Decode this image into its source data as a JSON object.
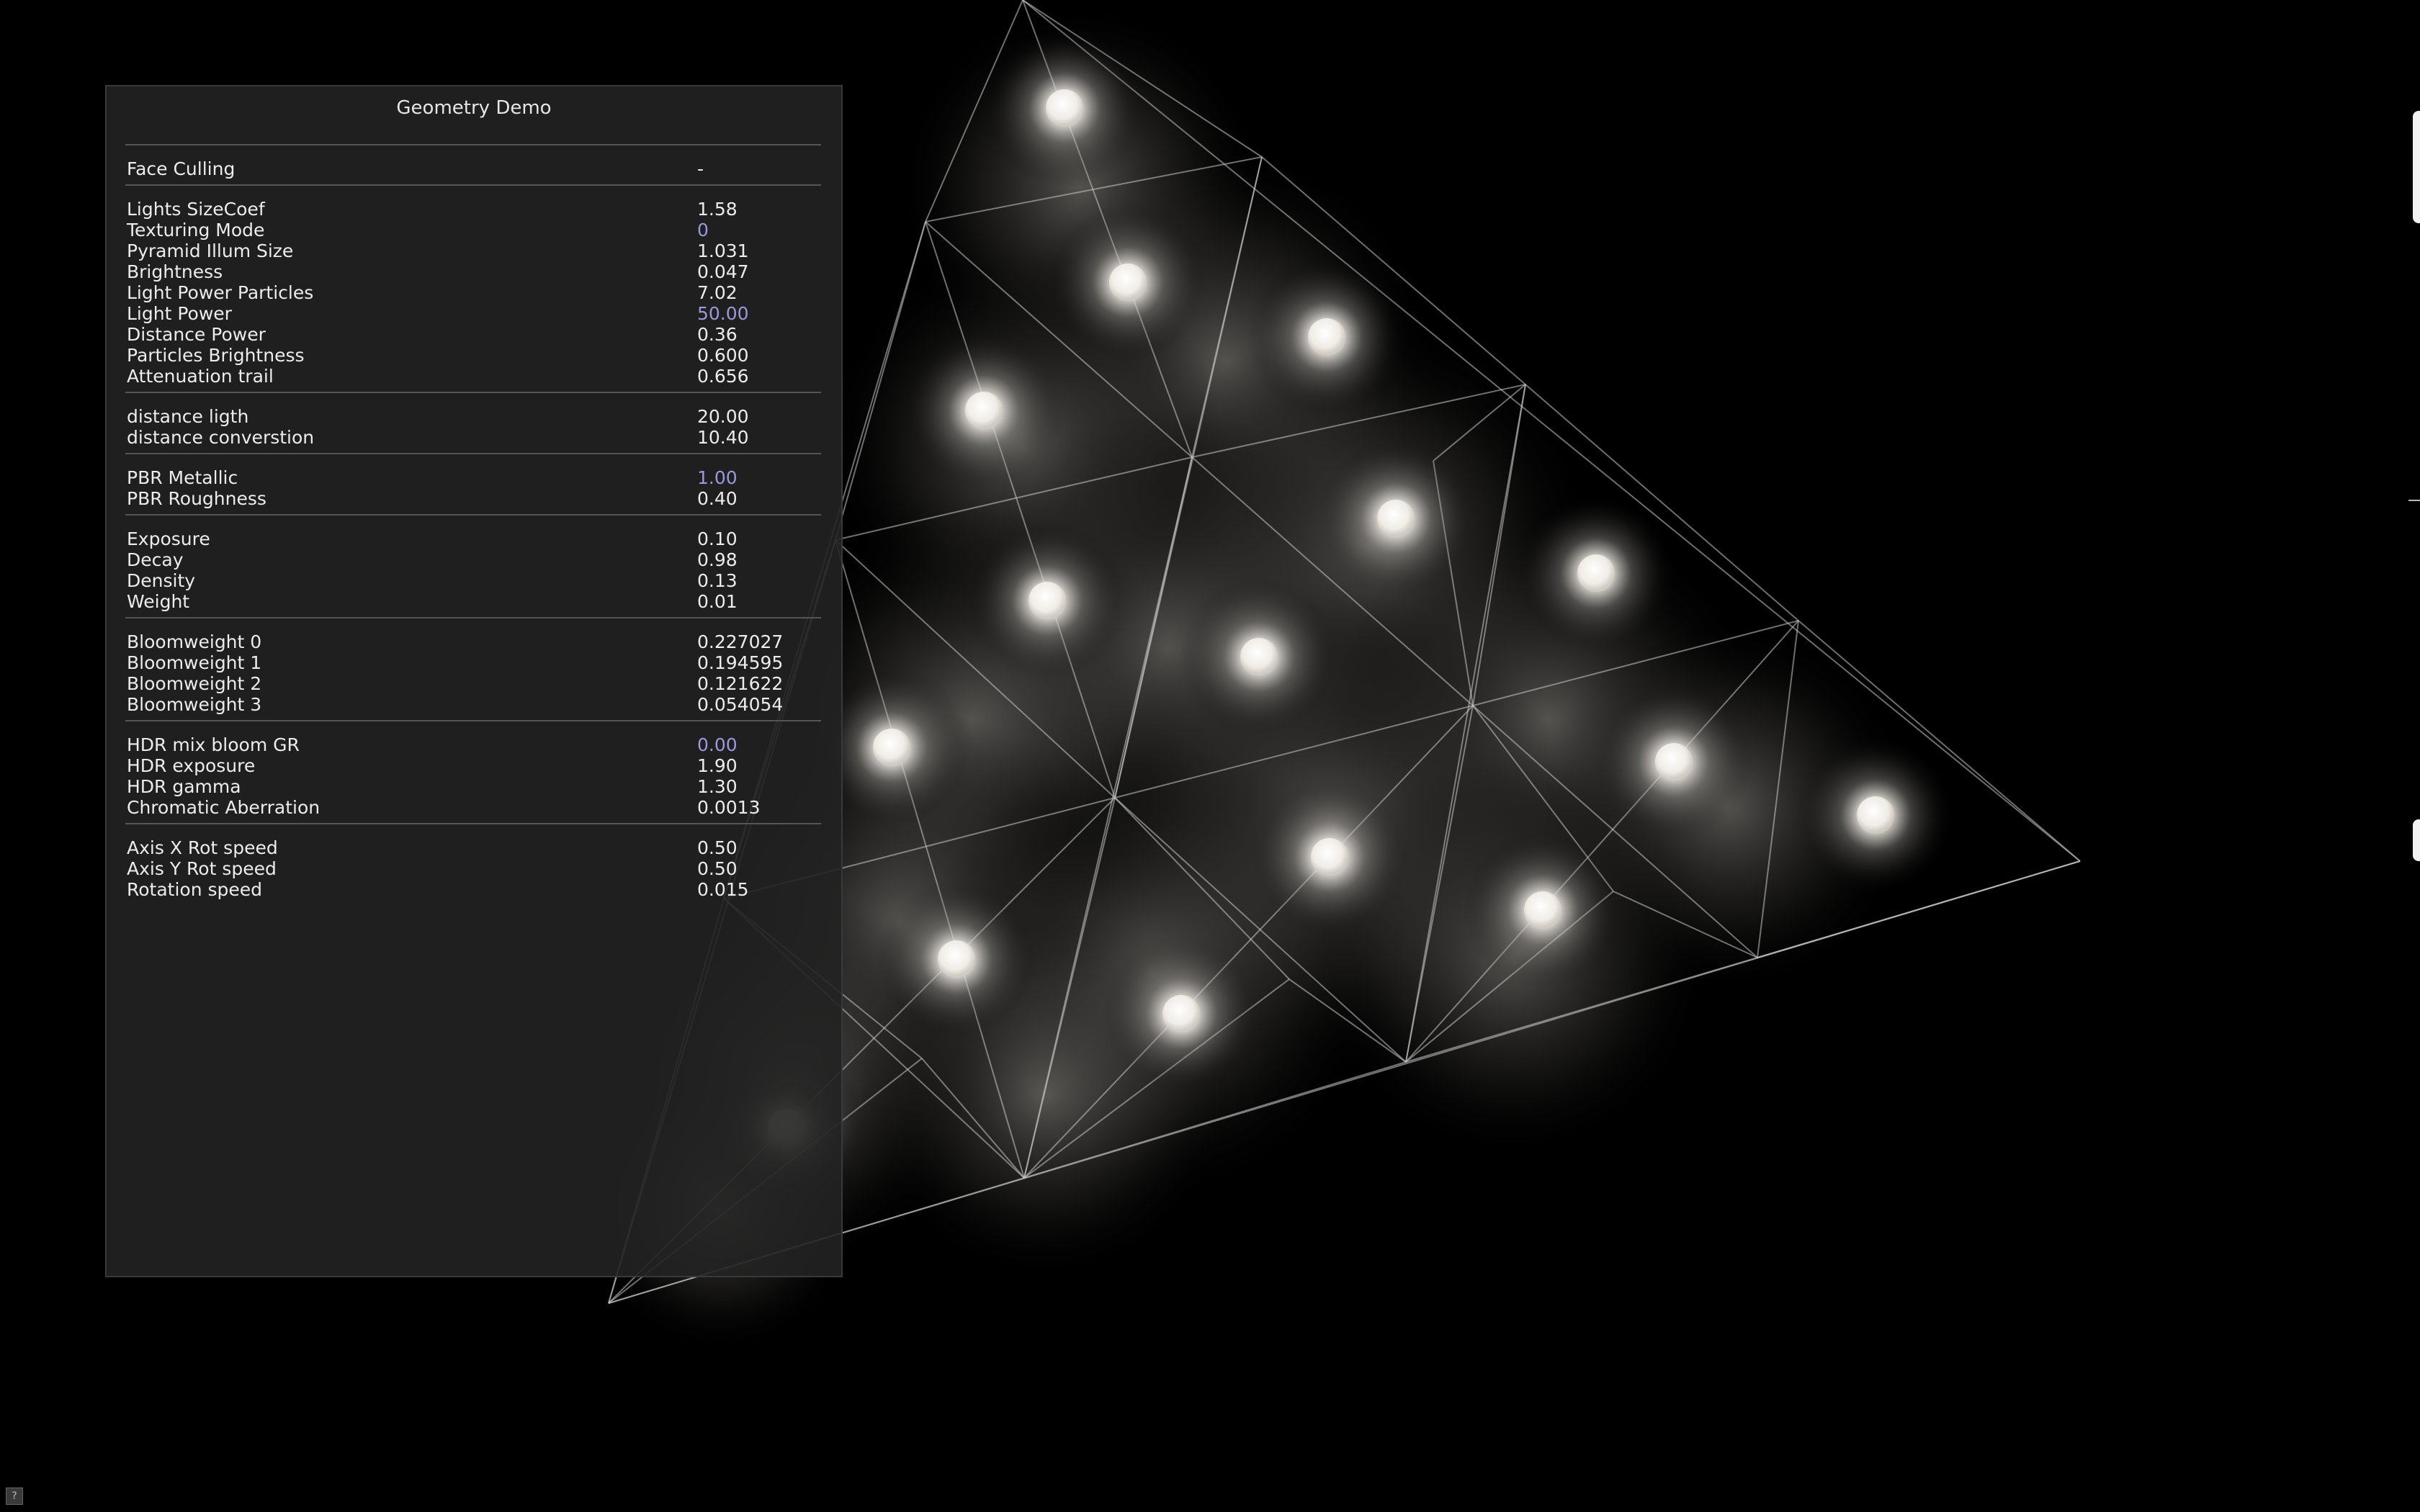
{
  "panel": {
    "title": "Geometry Demo",
    "groups": [
      {
        "rows": [
          {
            "label": "Face Culling",
            "value": "-",
            "highlight": false
          }
        ]
      },
      {
        "rows": [
          {
            "label": "Lights SizeCoef",
            "value": "1.58",
            "highlight": false
          },
          {
            "label": "Texturing Mode",
            "value": "0",
            "highlight": true
          },
          {
            "label": "Pyramid Illum Size",
            "value": "1.031",
            "highlight": false
          },
          {
            "label": "Brightness",
            "value": "0.047",
            "highlight": false
          },
          {
            "label": "Light Power Particles",
            "value": "7.02",
            "highlight": false
          },
          {
            "label": "Light Power",
            "value": "50.00",
            "highlight": true
          },
          {
            "label": "Distance Power",
            "value": "0.36",
            "highlight": false
          },
          {
            "label": "Particles Brightness",
            "value": "0.600",
            "highlight": false
          },
          {
            "label": "Attenuation trail",
            "value": "0.656",
            "highlight": false
          }
        ]
      },
      {
        "rows": [
          {
            "label": "distance ligth",
            "value": "20.00",
            "highlight": false
          },
          {
            "label": "distance converstion",
            "value": "10.40",
            "highlight": false
          }
        ]
      },
      {
        "rows": [
          {
            "label": "PBR Metallic",
            "value": "1.00",
            "highlight": true
          },
          {
            "label": "PBR Roughness",
            "value": "0.40",
            "highlight": false
          }
        ]
      },
      {
        "rows": [
          {
            "label": "Exposure",
            "value": "0.10",
            "highlight": false
          },
          {
            "label": "Decay",
            "value": "0.98",
            "highlight": false
          },
          {
            "label": "Density",
            "value": "0.13",
            "highlight": false
          },
          {
            "label": "Weight",
            "value": "0.01",
            "highlight": false
          }
        ]
      },
      {
        "rows": [
          {
            "label": "Bloomweight 0",
            "value": "0.227027",
            "highlight": false
          },
          {
            "label": "Bloomweight 1",
            "value": "0.194595",
            "highlight": false
          },
          {
            "label": "Bloomweight 2",
            "value": "0.121622",
            "highlight": false
          },
          {
            "label": "Bloomweight 3",
            "value": "0.054054",
            "highlight": false
          }
        ]
      },
      {
        "rows": [
          {
            "label": "HDR mix bloom GR",
            "value": "0.00",
            "highlight": true
          },
          {
            "label": "HDR exposure",
            "value": "1.90",
            "highlight": false
          },
          {
            "label": "HDR gamma",
            "value": "1.30",
            "highlight": false
          },
          {
            "label": "Chromatic Aberration",
            "value": "0.0013",
            "highlight": false
          }
        ]
      },
      {
        "rows": [
          {
            "label": "Axis X Rot speed",
            "value": "0.50",
            "highlight": false
          },
          {
            "label": "Axis Y Rot speed",
            "value": "0.50",
            "highlight": false
          },
          {
            "label": "Rotation speed",
            "value": "0.015",
            "highlight": false
          }
        ]
      }
    ]
  },
  "help_button": {
    "label": "?"
  },
  "colors": {
    "background": "#000000",
    "panel_bg": "#222222",
    "text": "#ececec",
    "highlight_value": "#9a99dd",
    "wire": "#c8c8c8"
  },
  "scene": {
    "icon": "pyramid-wireframe-icon"
  }
}
